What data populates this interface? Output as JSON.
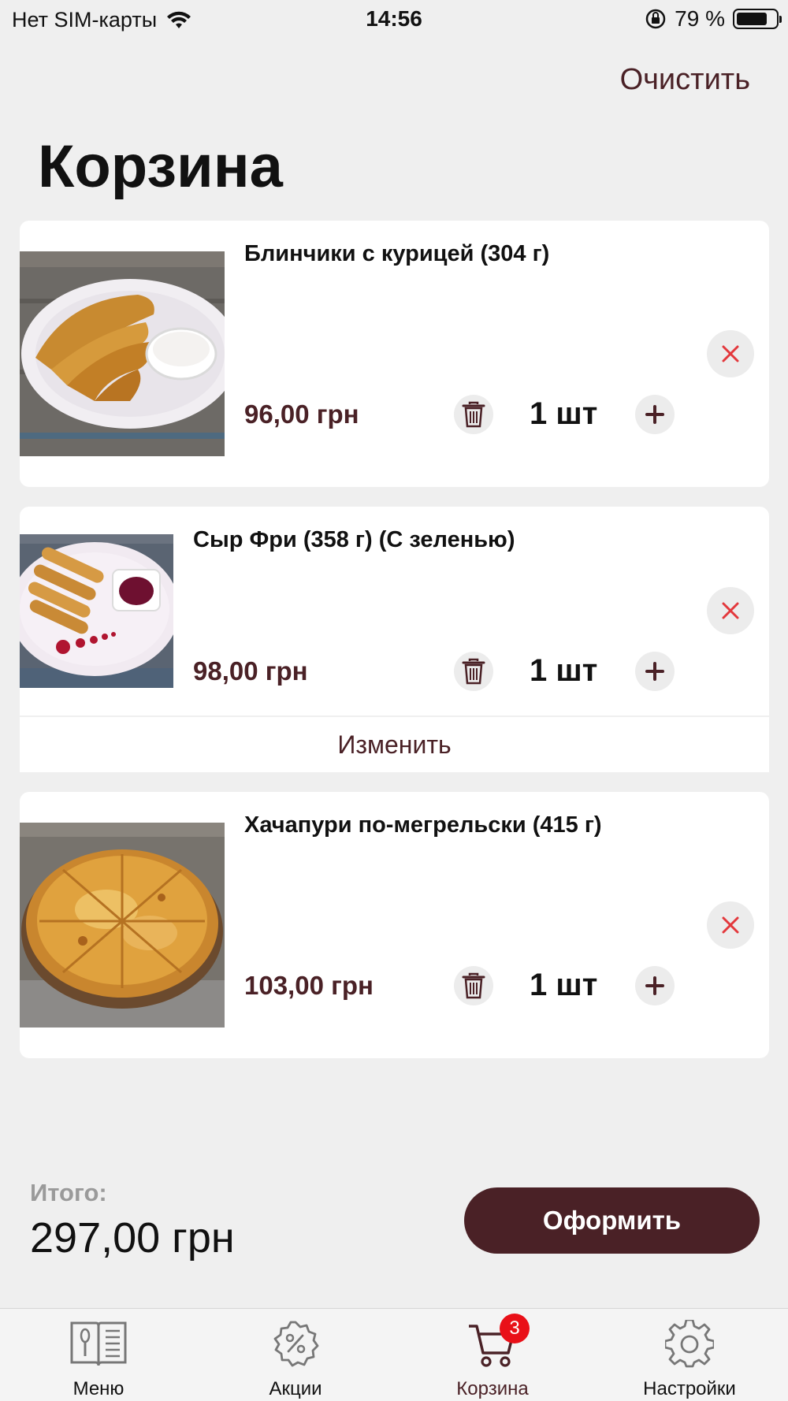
{
  "status_bar": {
    "carrier": "Нет SIM-карты",
    "time": "14:56",
    "battery": "79 %"
  },
  "header": {
    "clear_label": "Очистить",
    "title": "Корзина"
  },
  "cart": {
    "items": [
      {
        "name": "Блинчики с курицей (304 г)",
        "price": "96,00 грн",
        "qty": "1 шт",
        "image": "crepes-with-chicken-photo"
      },
      {
        "name": "Сыр Фри (358 г) (С зеленью)",
        "price": "98,00 грн",
        "qty": "1 шт",
        "image": "fried-cheese-sticks-photo",
        "edit_label": "Изменить"
      },
      {
        "name": "Хачапури по-мегрельски (415 г)",
        "price": "103,00 грн",
        "qty": "1 шт",
        "image": "khachapuri-photo"
      }
    ]
  },
  "summary": {
    "total_label": "Итого:",
    "total_value": "297,00 грн",
    "checkout_label": "Оформить"
  },
  "tab_bar": {
    "tabs": [
      {
        "label": "Меню",
        "icon": "menu-book-icon"
      },
      {
        "label": "Акции",
        "icon": "discount-badge-icon"
      },
      {
        "label": "Корзина",
        "icon": "cart-icon",
        "badge": "3",
        "active": true
      },
      {
        "label": "Настройки",
        "icon": "settings-gear-icon"
      }
    ]
  },
  "colors": {
    "accent": "#4a2126",
    "remove": "#e3383c",
    "badge": "#e91018",
    "background": "#efefef"
  }
}
